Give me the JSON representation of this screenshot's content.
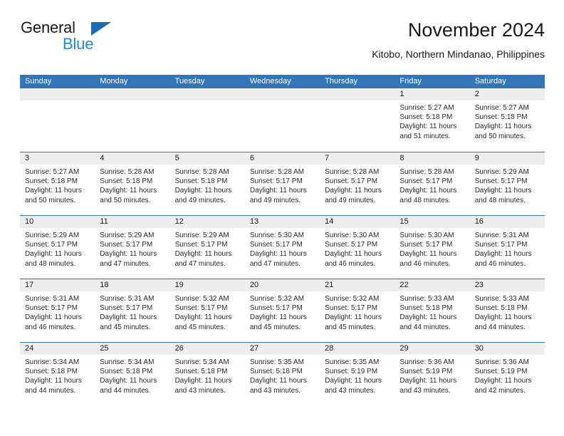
{
  "brand": {
    "word_one": "General",
    "word_two": "Blue",
    "triangle_color": "#1b6cb5",
    "blue_text_color": "#2389d6"
  },
  "header": {
    "title": "November 2024",
    "subtitle": "Kitobo, Northern Mindanao, Philippines"
  },
  "theme": {
    "header_blue": "#3275b9",
    "date_strip_gray": "#eeeeee",
    "text_color": "#1a1a1a"
  },
  "weekday_headers": [
    "Sunday",
    "Monday",
    "Tuesday",
    "Wednesday",
    "Thursday",
    "Friday",
    "Saturday"
  ],
  "weeks": [
    {
      "days": [
        {
          "date": "",
          "empty": true,
          "sunrise": "",
          "sunset": "",
          "daylight_line1": "",
          "daylight_line2": ""
        },
        {
          "date": "",
          "empty": true,
          "sunrise": "",
          "sunset": "",
          "daylight_line1": "",
          "daylight_line2": ""
        },
        {
          "date": "",
          "empty": true,
          "sunrise": "",
          "sunset": "",
          "daylight_line1": "",
          "daylight_line2": ""
        },
        {
          "date": "",
          "empty": true,
          "sunrise": "",
          "sunset": "",
          "daylight_line1": "",
          "daylight_line2": ""
        },
        {
          "date": "",
          "empty": true,
          "sunrise": "",
          "sunset": "",
          "daylight_line1": "",
          "daylight_line2": ""
        },
        {
          "date": "1",
          "empty": false,
          "sunrise": "Sunrise: 5:27 AM",
          "sunset": "Sunset: 5:18 PM",
          "daylight_line1": "Daylight: 11 hours",
          "daylight_line2": "and 51 minutes."
        },
        {
          "date": "2",
          "empty": false,
          "sunrise": "Sunrise: 5:27 AM",
          "sunset": "Sunset: 5:18 PM",
          "daylight_line1": "Daylight: 11 hours",
          "daylight_line2": "and 50 minutes."
        }
      ]
    },
    {
      "days": [
        {
          "date": "3",
          "empty": false,
          "sunrise": "Sunrise: 5:27 AM",
          "sunset": "Sunset: 5:18 PM",
          "daylight_line1": "Daylight: 11 hours",
          "daylight_line2": "and 50 minutes."
        },
        {
          "date": "4",
          "empty": false,
          "sunrise": "Sunrise: 5:28 AM",
          "sunset": "Sunset: 5:18 PM",
          "daylight_line1": "Daylight: 11 hours",
          "daylight_line2": "and 50 minutes."
        },
        {
          "date": "5",
          "empty": false,
          "sunrise": "Sunrise: 5:28 AM",
          "sunset": "Sunset: 5:18 PM",
          "daylight_line1": "Daylight: 11 hours",
          "daylight_line2": "and 49 minutes."
        },
        {
          "date": "6",
          "empty": false,
          "sunrise": "Sunrise: 5:28 AM",
          "sunset": "Sunset: 5:17 PM",
          "daylight_line1": "Daylight: 11 hours",
          "daylight_line2": "and 49 minutes."
        },
        {
          "date": "7",
          "empty": false,
          "sunrise": "Sunrise: 5:28 AM",
          "sunset": "Sunset: 5:17 PM",
          "daylight_line1": "Daylight: 11 hours",
          "daylight_line2": "and 49 minutes."
        },
        {
          "date": "8",
          "empty": false,
          "sunrise": "Sunrise: 5:28 AM",
          "sunset": "Sunset: 5:17 PM",
          "daylight_line1": "Daylight: 11 hours",
          "daylight_line2": "and 48 minutes."
        },
        {
          "date": "9",
          "empty": false,
          "sunrise": "Sunrise: 5:29 AM",
          "sunset": "Sunset: 5:17 PM",
          "daylight_line1": "Daylight: 11 hours",
          "daylight_line2": "and 48 minutes."
        }
      ]
    },
    {
      "days": [
        {
          "date": "10",
          "empty": false,
          "sunrise": "Sunrise: 5:29 AM",
          "sunset": "Sunset: 5:17 PM",
          "daylight_line1": "Daylight: 11 hours",
          "daylight_line2": "and 48 minutes."
        },
        {
          "date": "11",
          "empty": false,
          "sunrise": "Sunrise: 5:29 AM",
          "sunset": "Sunset: 5:17 PM",
          "daylight_line1": "Daylight: 11 hours",
          "daylight_line2": "and 47 minutes."
        },
        {
          "date": "12",
          "empty": false,
          "sunrise": "Sunrise: 5:29 AM",
          "sunset": "Sunset: 5:17 PM",
          "daylight_line1": "Daylight: 11 hours",
          "daylight_line2": "and 47 minutes."
        },
        {
          "date": "13",
          "empty": false,
          "sunrise": "Sunrise: 5:30 AM",
          "sunset": "Sunset: 5:17 PM",
          "daylight_line1": "Daylight: 11 hours",
          "daylight_line2": "and 47 minutes."
        },
        {
          "date": "14",
          "empty": false,
          "sunrise": "Sunrise: 5:30 AM",
          "sunset": "Sunset: 5:17 PM",
          "daylight_line1": "Daylight: 11 hours",
          "daylight_line2": "and 46 minutes."
        },
        {
          "date": "15",
          "empty": false,
          "sunrise": "Sunrise: 5:30 AM",
          "sunset": "Sunset: 5:17 PM",
          "daylight_line1": "Daylight: 11 hours",
          "daylight_line2": "and 46 minutes."
        },
        {
          "date": "16",
          "empty": false,
          "sunrise": "Sunrise: 5:31 AM",
          "sunset": "Sunset: 5:17 PM",
          "daylight_line1": "Daylight: 11 hours",
          "daylight_line2": "and 46 minutes."
        }
      ]
    },
    {
      "days": [
        {
          "date": "17",
          "empty": false,
          "sunrise": "Sunrise: 5:31 AM",
          "sunset": "Sunset: 5:17 PM",
          "daylight_line1": "Daylight: 11 hours",
          "daylight_line2": "and 46 minutes."
        },
        {
          "date": "18",
          "empty": false,
          "sunrise": "Sunrise: 5:31 AM",
          "sunset": "Sunset: 5:17 PM",
          "daylight_line1": "Daylight: 11 hours",
          "daylight_line2": "and 45 minutes."
        },
        {
          "date": "19",
          "empty": false,
          "sunrise": "Sunrise: 5:32 AM",
          "sunset": "Sunset: 5:17 PM",
          "daylight_line1": "Daylight: 11 hours",
          "daylight_line2": "and 45 minutes."
        },
        {
          "date": "20",
          "empty": false,
          "sunrise": "Sunrise: 5:32 AM",
          "sunset": "Sunset: 5:17 PM",
          "daylight_line1": "Daylight: 11 hours",
          "daylight_line2": "and 45 minutes."
        },
        {
          "date": "21",
          "empty": false,
          "sunrise": "Sunrise: 5:32 AM",
          "sunset": "Sunset: 5:17 PM",
          "daylight_line1": "Daylight: 11 hours",
          "daylight_line2": "and 45 minutes."
        },
        {
          "date": "22",
          "empty": false,
          "sunrise": "Sunrise: 5:33 AM",
          "sunset": "Sunset: 5:18 PM",
          "daylight_line1": "Daylight: 11 hours",
          "daylight_line2": "and 44 minutes."
        },
        {
          "date": "23",
          "empty": false,
          "sunrise": "Sunrise: 5:33 AM",
          "sunset": "Sunset: 5:18 PM",
          "daylight_line1": "Daylight: 11 hours",
          "daylight_line2": "and 44 minutes."
        }
      ]
    },
    {
      "days": [
        {
          "date": "24",
          "empty": false,
          "sunrise": "Sunrise: 5:34 AM",
          "sunset": "Sunset: 5:18 PM",
          "daylight_line1": "Daylight: 11 hours",
          "daylight_line2": "and 44 minutes."
        },
        {
          "date": "25",
          "empty": false,
          "sunrise": "Sunrise: 5:34 AM",
          "sunset": "Sunset: 5:18 PM",
          "daylight_line1": "Daylight: 11 hours",
          "daylight_line2": "and 44 minutes."
        },
        {
          "date": "26",
          "empty": false,
          "sunrise": "Sunrise: 5:34 AM",
          "sunset": "Sunset: 5:18 PM",
          "daylight_line1": "Daylight: 11 hours",
          "daylight_line2": "and 43 minutes."
        },
        {
          "date": "27",
          "empty": false,
          "sunrise": "Sunrise: 5:35 AM",
          "sunset": "Sunset: 5:18 PM",
          "daylight_line1": "Daylight: 11 hours",
          "daylight_line2": "and 43 minutes."
        },
        {
          "date": "28",
          "empty": false,
          "sunrise": "Sunrise: 5:35 AM",
          "sunset": "Sunset: 5:19 PM",
          "daylight_line1": "Daylight: 11 hours",
          "daylight_line2": "and 43 minutes."
        },
        {
          "date": "29",
          "empty": false,
          "sunrise": "Sunrise: 5:36 AM",
          "sunset": "Sunset: 5:19 PM",
          "daylight_line1": "Daylight: 11 hours",
          "daylight_line2": "and 43 minutes."
        },
        {
          "date": "30",
          "empty": false,
          "sunrise": "Sunrise: 5:36 AM",
          "sunset": "Sunset: 5:19 PM",
          "daylight_line1": "Daylight: 11 hours",
          "daylight_line2": "and 42 minutes."
        }
      ]
    }
  ]
}
